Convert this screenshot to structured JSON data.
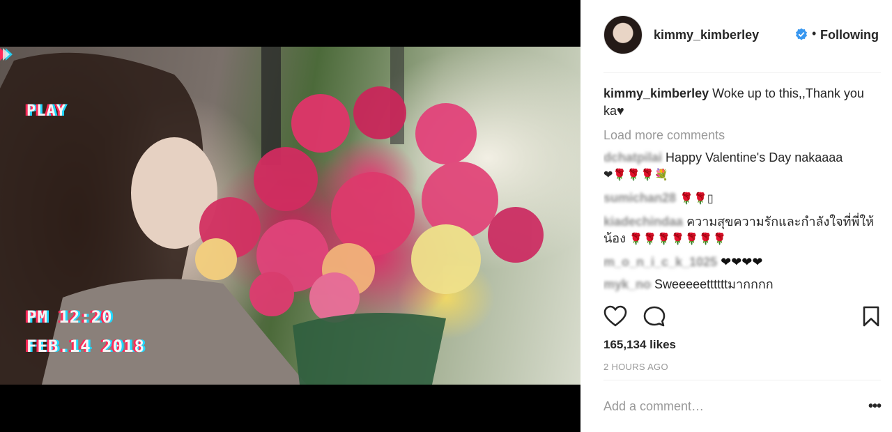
{
  "media": {
    "overlay_play": "PLAY",
    "overlay_time": "PM 12:20",
    "overlay_date": "FEB.14 2018"
  },
  "header": {
    "username": "kimmy_kimberley",
    "separator": "•",
    "follow_status": "Following"
  },
  "caption": {
    "username": "kimmy_kimberley",
    "text": "Woke up to this,,Thank you ka♥"
  },
  "load_more": "Load more comments",
  "comments": [
    {
      "username": "dchatpilai",
      "text": "Happy Valentine's Day nakaaaa",
      "extra": "❤🌹🌹🌹💐"
    },
    {
      "username": "sumichan28",
      "text": "🌹🌹▯"
    },
    {
      "username": "kiadechindaa",
      "text": "ความสุขความรักและกำลังใจที่พี่ให้น้อง",
      "extra": "🌹🌹🌹🌹🌹🌹🌹"
    },
    {
      "username": "m_o_n_i_c_k_1025",
      "text": "❤❤❤❤"
    },
    {
      "username": "myk_no",
      "text": "Sweeeeettttttมากกกก"
    }
  ],
  "likes": "165,134 likes",
  "time_ago": "2 HOURS AGO",
  "add_comment_placeholder": "Add a comment…",
  "more_menu": "•••",
  "colors": {
    "verified": "#3897f0",
    "rose": "#d8232a"
  }
}
